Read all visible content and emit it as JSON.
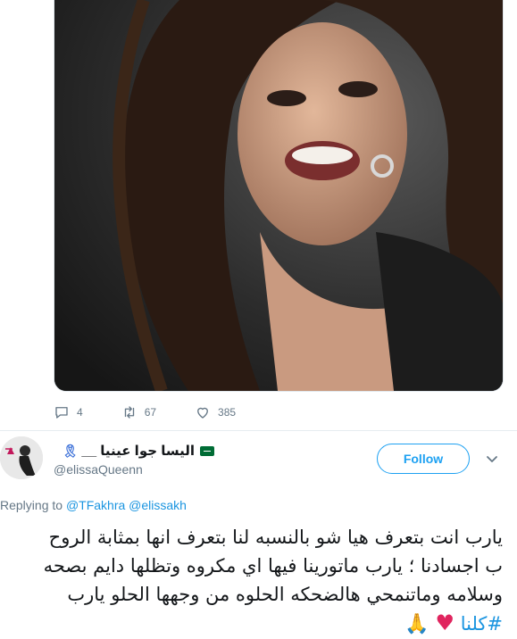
{
  "tweet": {
    "actions": {
      "reply_count": "4",
      "retweet_count": "67",
      "like_count": "385"
    }
  },
  "reply": {
    "display_name": "اليسا جوا عينيا __",
    "handle": "@elissaQueenn",
    "follow_label": "Follow",
    "replying_to_label": "Replying to",
    "replying_to_users": [
      "@TFakhra",
      "@elissakh"
    ],
    "text_lines": [
      "يارب انت بتعرف هيا شو بالنسبه لنا بتعرف انها بمثابة الروح",
      "ب اجسادنا ؛ يارب ماتورينا فيها اي مكروه وتظلها دايم بصحه",
      "وسلامه وماتنمحي هالضحكه الحلوه من وجهها الحلو يارب"
    ],
    "hashtag": "#كلنا",
    "emoji_heart": "♥",
    "emoji_pray": "🙏"
  },
  "icons": {
    "reply": "reply-icon",
    "retweet": "retweet-icon",
    "like": "like-icon",
    "chevron": "chevron-down-icon",
    "flag": "flag-icon",
    "ribbon": "ribbon-icon"
  },
  "colors": {
    "accent": "#1da1f2",
    "link": "#1b95e0",
    "secondary_text": "#657786",
    "heart": "#e0245e"
  }
}
